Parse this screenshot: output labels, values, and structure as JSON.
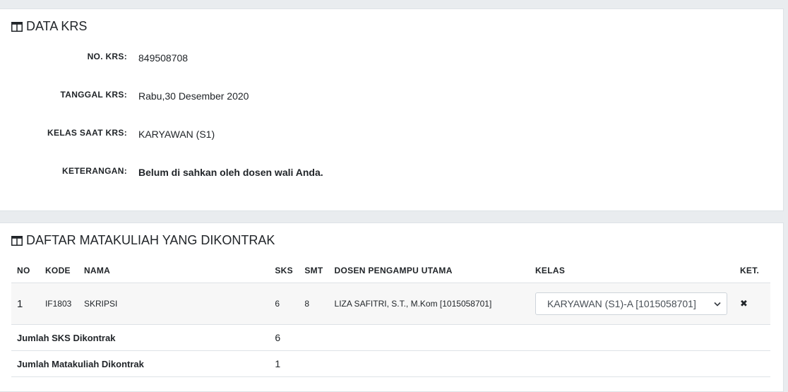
{
  "data_krs": {
    "title": "DATA KRS",
    "rows": [
      {
        "label": "NO. KRS:",
        "value": "849508708"
      },
      {
        "label": "TANGGAL KRS:",
        "value": "Rabu,30 Desember 2020"
      },
      {
        "label": "KELAS SAAT KRS:",
        "value": "KARYAWAN (S1)"
      },
      {
        "label": "KETERANGAN:",
        "value": "Belum di sahkan oleh dosen wali Anda."
      }
    ]
  },
  "matakuliah": {
    "title": "DAFTAR MATAKULIAH YANG DIKONTRAK",
    "headers": {
      "no": "NO",
      "kode": "KODE",
      "nama": "NAMA",
      "sks": "SKS",
      "smt": "SMT",
      "dosen": "DOSEN PENGAMPU UTAMA",
      "kelas": "KELAS",
      "ket": "KET."
    },
    "rows": [
      {
        "no": "1",
        "kode": "IF1803",
        "nama": "SKRIPSI",
        "sks": "6",
        "smt": "8",
        "dosen": "LIZA SAFITRI, S.T., M.Kom [1015058701]",
        "kelas": "KARYAWAN (S1)-A [1015058701]",
        "ket_icon": "close-icon"
      }
    ],
    "summary": [
      {
        "label": "Jumlah SKS Dikontrak",
        "value": "6"
      },
      {
        "label": "Jumlah Matakuliah Dikontrak",
        "value": "1"
      }
    ]
  }
}
